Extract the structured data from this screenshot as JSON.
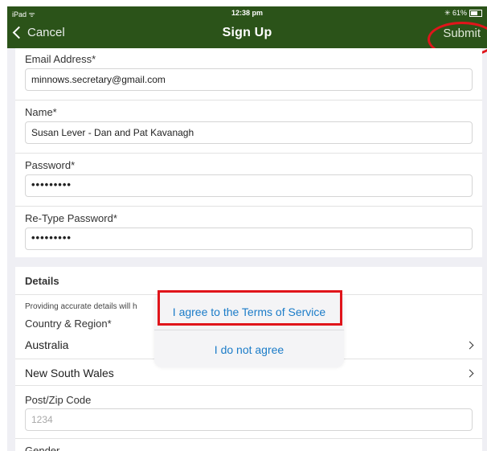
{
  "status": {
    "left": "iPad ᯤ",
    "time": "12:38 pm",
    "right": "✳ 61%"
  },
  "nav": {
    "cancel": "Cancel",
    "title": "Sign Up",
    "submit": "Submit"
  },
  "form": {
    "email_label": "Email Address*",
    "email_value": "minnows.secretary@gmail.com",
    "name_label": "Name*",
    "name_value": "Susan Lever - Dan and Pat Kavanagh",
    "password_label": "Password*",
    "password_value": "•••••••••",
    "retype_label": "Re-Type Password*",
    "retype_value": "•••••••••"
  },
  "details": {
    "heading": "Details",
    "info": "Providing accurate details will h",
    "country_label": "Country & Region*",
    "country_value": "Australia",
    "region_value": "New South Wales",
    "postcode_label": "Post/Zip Code",
    "postcode_placeholder": "1234",
    "gender_label": "Gender"
  },
  "dialog": {
    "agree": "I agree to the Terms of Service",
    "disagree": "I do not agree"
  },
  "colors": {
    "navbar": "#2b5319",
    "link": "#1b7cc8",
    "highlight": "#e0151b"
  }
}
